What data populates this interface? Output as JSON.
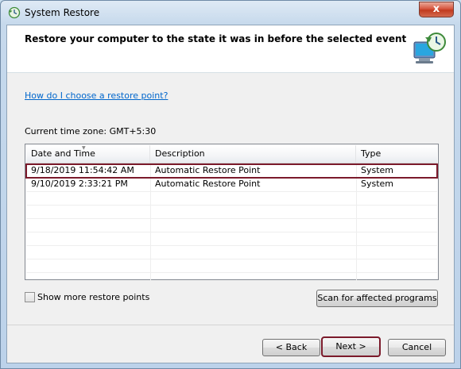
{
  "window": {
    "title": "System Restore",
    "close_glyph": "x"
  },
  "header": {
    "title": "Restore your computer to the state it was in before the selected event"
  },
  "help_link": "How do I choose a restore point?",
  "timezone_label": "Current time zone: GMT+5:30",
  "table": {
    "columns": [
      "Date and Time",
      "Description",
      "Type"
    ],
    "sorted_column": "Date and Time",
    "rows": [
      {
        "date": "9/18/2019 11:54:42 AM",
        "description": "Automatic Restore Point",
        "type": "System",
        "selected": true
      },
      {
        "date": "9/10/2019 2:33:21 PM",
        "description": "Automatic Restore Point",
        "type": "System",
        "selected": false
      }
    ]
  },
  "show_more": {
    "label": "Show more restore points",
    "checked": false
  },
  "buttons": {
    "scan": "Scan for affected programs",
    "back": "< Back",
    "next": "Next >",
    "cancel": "Cancel"
  },
  "colors": {
    "highlight_outline": "#7b1a2b",
    "link": "#0066cc",
    "close_button": "#c13a1f"
  },
  "icons": {
    "title": "system-restore-icon",
    "header": "computer-restore-clock-icon"
  }
}
